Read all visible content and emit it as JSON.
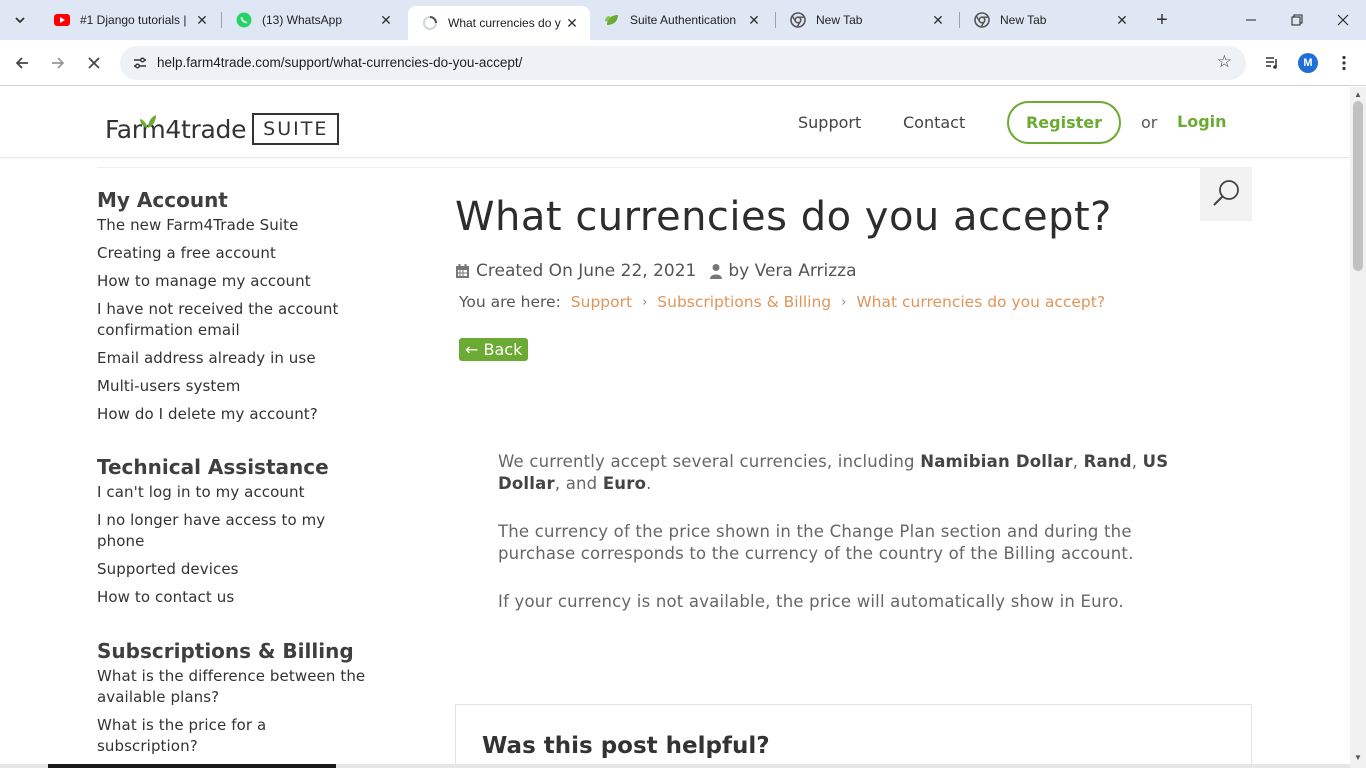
{
  "browser": {
    "tabs": [
      {
        "title": "#1 Django tutorials | ",
        "icon": "youtube-icon"
      },
      {
        "title": "(13) WhatsApp",
        "icon": "whatsapp-icon"
      },
      {
        "title": "What currencies do y",
        "icon": "loading-icon",
        "active": true
      },
      {
        "title": "Suite Authentication",
        "icon": "leaf-icon"
      },
      {
        "title": "New Tab",
        "icon": "chrome-icon"
      },
      {
        "title": "New Tab",
        "icon": "chrome-icon"
      }
    ],
    "url": "help.farm4trade.com/support/what-currencies-do-you-accept/",
    "profile_initial": "M",
    "loading_progress": 0.25
  },
  "header": {
    "logo_text": "Farm4trade",
    "logo_suite": "SUITE",
    "nav_support": "Support",
    "nav_contact": "Contact",
    "register": "Register",
    "or": "or",
    "login": "Login"
  },
  "sidebar": {
    "sections": [
      {
        "heading": "My Account",
        "links": [
          "The new Farm4Trade Suite",
          "Creating a free account",
          "How to manage my account",
          "I have not received the account confirmation email",
          "Email address already in use",
          "Multi-users system",
          "How do I delete my account?"
        ]
      },
      {
        "heading": "Technical Assistance",
        "links": [
          "I can't log in to my account",
          "I no longer have access to my phone",
          "Supported devices",
          "How to contact us"
        ]
      },
      {
        "heading": "Subscriptions & Billing",
        "links": [
          "What is the difference between the available plans?",
          "What is the price for a subscription?"
        ]
      }
    ]
  },
  "post": {
    "title": "What currencies do you accept?",
    "created": "Created On June 22, 2021",
    "author": "by Vera Arrizza",
    "breadcrumb_label": "You are here:",
    "breadcrumb": [
      "Support",
      "Subscriptions & Billing",
      "What currencies do you accept?"
    ],
    "back": "← Back",
    "p1_pre": "We currently accept several currencies, including ",
    "p1_cur1": "Namibian Dollar",
    "p1_comma1": ", ",
    "p1_cur2": "Rand",
    "p1_comma2": ", ",
    "p1_cur3": "US Dollar",
    "p1_and": ", and ",
    "p1_cur4": "Euro",
    "p1_end": ".",
    "p2": "The currency of the price shown in the Change Plan section and during the purchase corresponds to the currency of the country of the Billing account.",
    "p3": "If your currency is not available, the price will automatically show in Euro.",
    "helpful": "Was this post helpful?"
  },
  "colors": {
    "accent_green": "#6bab33",
    "breadcrumb_orange": "#e0955a"
  }
}
